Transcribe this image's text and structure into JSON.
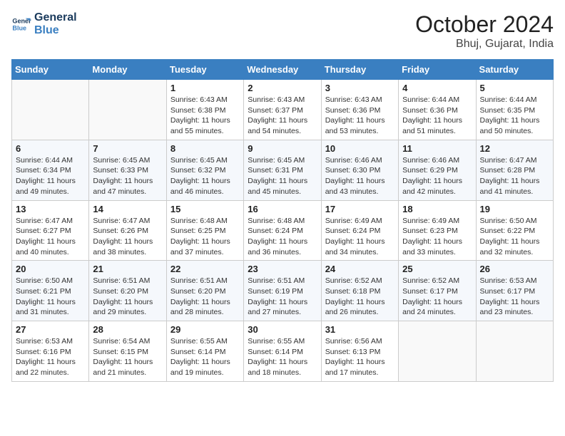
{
  "header": {
    "logo_line1": "General",
    "logo_line2": "Blue",
    "month": "October 2024",
    "location": "Bhuj, Gujarat, India"
  },
  "weekdays": [
    "Sunday",
    "Monday",
    "Tuesday",
    "Wednesday",
    "Thursday",
    "Friday",
    "Saturday"
  ],
  "weeks": [
    [
      {
        "day": "",
        "info": ""
      },
      {
        "day": "",
        "info": ""
      },
      {
        "day": "1",
        "info": "Sunrise: 6:43 AM\nSunset: 6:38 PM\nDaylight: 11 hours and 55 minutes."
      },
      {
        "day": "2",
        "info": "Sunrise: 6:43 AM\nSunset: 6:37 PM\nDaylight: 11 hours and 54 minutes."
      },
      {
        "day": "3",
        "info": "Sunrise: 6:43 AM\nSunset: 6:36 PM\nDaylight: 11 hours and 53 minutes."
      },
      {
        "day": "4",
        "info": "Sunrise: 6:44 AM\nSunset: 6:36 PM\nDaylight: 11 hours and 51 minutes."
      },
      {
        "day": "5",
        "info": "Sunrise: 6:44 AM\nSunset: 6:35 PM\nDaylight: 11 hours and 50 minutes."
      }
    ],
    [
      {
        "day": "6",
        "info": "Sunrise: 6:44 AM\nSunset: 6:34 PM\nDaylight: 11 hours and 49 minutes."
      },
      {
        "day": "7",
        "info": "Sunrise: 6:45 AM\nSunset: 6:33 PM\nDaylight: 11 hours and 47 minutes."
      },
      {
        "day": "8",
        "info": "Sunrise: 6:45 AM\nSunset: 6:32 PM\nDaylight: 11 hours and 46 minutes."
      },
      {
        "day": "9",
        "info": "Sunrise: 6:45 AM\nSunset: 6:31 PM\nDaylight: 11 hours and 45 minutes."
      },
      {
        "day": "10",
        "info": "Sunrise: 6:46 AM\nSunset: 6:30 PM\nDaylight: 11 hours and 43 minutes."
      },
      {
        "day": "11",
        "info": "Sunrise: 6:46 AM\nSunset: 6:29 PM\nDaylight: 11 hours and 42 minutes."
      },
      {
        "day": "12",
        "info": "Sunrise: 6:47 AM\nSunset: 6:28 PM\nDaylight: 11 hours and 41 minutes."
      }
    ],
    [
      {
        "day": "13",
        "info": "Sunrise: 6:47 AM\nSunset: 6:27 PM\nDaylight: 11 hours and 40 minutes."
      },
      {
        "day": "14",
        "info": "Sunrise: 6:47 AM\nSunset: 6:26 PM\nDaylight: 11 hours and 38 minutes."
      },
      {
        "day": "15",
        "info": "Sunrise: 6:48 AM\nSunset: 6:25 PM\nDaylight: 11 hours and 37 minutes."
      },
      {
        "day": "16",
        "info": "Sunrise: 6:48 AM\nSunset: 6:24 PM\nDaylight: 11 hours and 36 minutes."
      },
      {
        "day": "17",
        "info": "Sunrise: 6:49 AM\nSunset: 6:24 PM\nDaylight: 11 hours and 34 minutes."
      },
      {
        "day": "18",
        "info": "Sunrise: 6:49 AM\nSunset: 6:23 PM\nDaylight: 11 hours and 33 minutes."
      },
      {
        "day": "19",
        "info": "Sunrise: 6:50 AM\nSunset: 6:22 PM\nDaylight: 11 hours and 32 minutes."
      }
    ],
    [
      {
        "day": "20",
        "info": "Sunrise: 6:50 AM\nSunset: 6:21 PM\nDaylight: 11 hours and 31 minutes."
      },
      {
        "day": "21",
        "info": "Sunrise: 6:51 AM\nSunset: 6:20 PM\nDaylight: 11 hours and 29 minutes."
      },
      {
        "day": "22",
        "info": "Sunrise: 6:51 AM\nSunset: 6:20 PM\nDaylight: 11 hours and 28 minutes."
      },
      {
        "day": "23",
        "info": "Sunrise: 6:51 AM\nSunset: 6:19 PM\nDaylight: 11 hours and 27 minutes."
      },
      {
        "day": "24",
        "info": "Sunrise: 6:52 AM\nSunset: 6:18 PM\nDaylight: 11 hours and 26 minutes."
      },
      {
        "day": "25",
        "info": "Sunrise: 6:52 AM\nSunset: 6:17 PM\nDaylight: 11 hours and 24 minutes."
      },
      {
        "day": "26",
        "info": "Sunrise: 6:53 AM\nSunset: 6:17 PM\nDaylight: 11 hours and 23 minutes."
      }
    ],
    [
      {
        "day": "27",
        "info": "Sunrise: 6:53 AM\nSunset: 6:16 PM\nDaylight: 11 hours and 22 minutes."
      },
      {
        "day": "28",
        "info": "Sunrise: 6:54 AM\nSunset: 6:15 PM\nDaylight: 11 hours and 21 minutes."
      },
      {
        "day": "29",
        "info": "Sunrise: 6:55 AM\nSunset: 6:14 PM\nDaylight: 11 hours and 19 minutes."
      },
      {
        "day": "30",
        "info": "Sunrise: 6:55 AM\nSunset: 6:14 PM\nDaylight: 11 hours and 18 minutes."
      },
      {
        "day": "31",
        "info": "Sunrise: 6:56 AM\nSunset: 6:13 PM\nDaylight: 11 hours and 17 minutes."
      },
      {
        "day": "",
        "info": ""
      },
      {
        "day": "",
        "info": ""
      }
    ]
  ]
}
